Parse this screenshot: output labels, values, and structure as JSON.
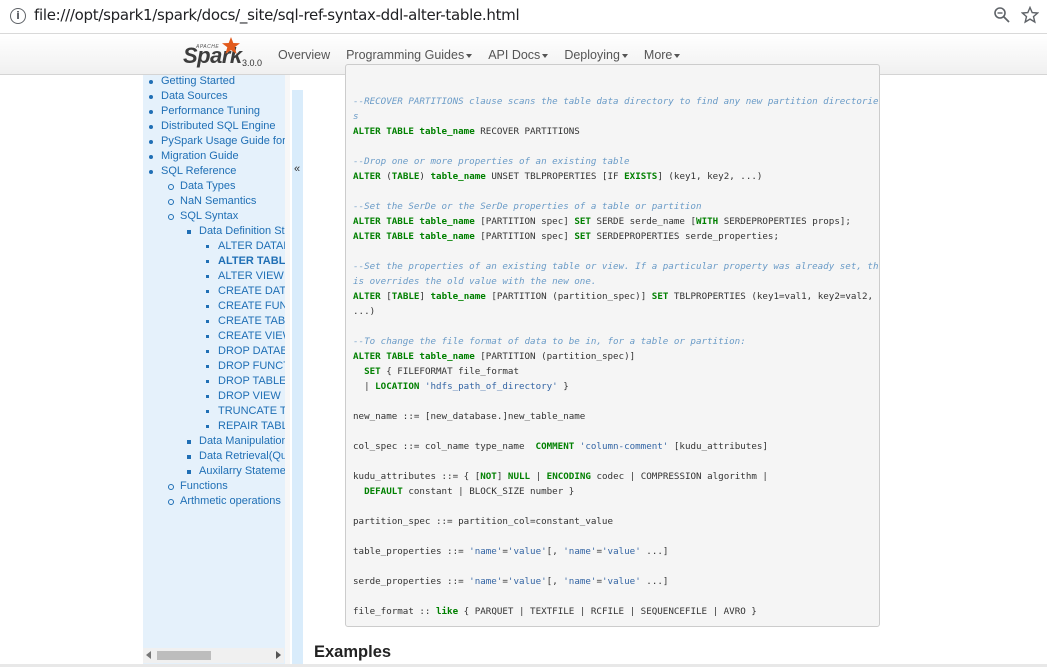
{
  "browser": {
    "url": "file:///opt/spark1/spark/docs/_site/sql-ref-syntax-ddl-alter-table.html",
    "info_icon": "i"
  },
  "navbar": {
    "brand_apache": "APACHE",
    "brand_name": "Spark",
    "version": "3.0.0",
    "items": [
      {
        "label": "Overview",
        "dropdown": false
      },
      {
        "label": "Programming Guides",
        "dropdown": true
      },
      {
        "label": "API Docs",
        "dropdown": true
      },
      {
        "label": "Deploying",
        "dropdown": true
      },
      {
        "label": "More",
        "dropdown": true
      }
    ]
  },
  "sidebar": {
    "items": [
      {
        "label": "Getting Started",
        "level": 0
      },
      {
        "label": "Data Sources",
        "level": 0
      },
      {
        "label": "Performance Tuning",
        "level": 0
      },
      {
        "label": "Distributed SQL Engine",
        "level": 0
      },
      {
        "label": "PySpark Usage Guide for P",
        "level": 0
      },
      {
        "label": "Migration Guide",
        "level": 0
      },
      {
        "label": "SQL Reference",
        "level": 0
      },
      {
        "label": "Data Types",
        "level": 1
      },
      {
        "label": "NaN Semantics",
        "level": 1
      },
      {
        "label": "SQL Syntax",
        "level": 1
      },
      {
        "label": "Data Definition Sta",
        "level": 2
      },
      {
        "label": "ALTER DATAB",
        "level": 3
      },
      {
        "label": "ALTER TABLE",
        "level": 3,
        "active": true
      },
      {
        "label": "ALTER VIEW",
        "level": 3
      },
      {
        "label": "CREATE DATA",
        "level": 3
      },
      {
        "label": "CREATE FUNC",
        "level": 3
      },
      {
        "label": "CREATE TABL",
        "level": 3
      },
      {
        "label": "CREATE VIEW",
        "level": 3
      },
      {
        "label": "DROP DATAB",
        "level": 3
      },
      {
        "label": "DROP FUNCT",
        "level": 3
      },
      {
        "label": "DROP TABLE",
        "level": 3
      },
      {
        "label": "DROP VIEW",
        "level": 3
      },
      {
        "label": "TRUNCATE TA",
        "level": 3
      },
      {
        "label": "REPAIR TABL",
        "level": 3
      },
      {
        "label": "Data Manipulation",
        "level": 2
      },
      {
        "label": "Data Retrieval(Que",
        "level": 2
      },
      {
        "label": "Auxilarry Statemen",
        "level": 2
      },
      {
        "label": "Functions",
        "level": 1
      },
      {
        "label": "Arthmetic operations",
        "level": 1
      }
    ],
    "collapse_glyph": "«"
  },
  "code_lines": [
    [
      [
        "cm",
        "--RECOVER PARTITIONS clause scans the table data directory to find any new partition directorie"
      ]
    ],
    [
      [
        "cm",
        "s"
      ]
    ],
    [
      [
        "kw",
        "ALTER TABLE"
      ],
      [
        "t",
        " "
      ],
      [
        "kw",
        "table_name"
      ],
      [
        "t",
        " RECOVER PARTITIONS"
      ]
    ],
    [],
    [
      [
        "cm",
        "--Drop one or more properties of an existing table"
      ]
    ],
    [
      [
        "kw",
        "ALTER"
      ],
      [
        "t",
        " ("
      ],
      [
        "kw",
        "TABLE"
      ],
      [
        "t",
        ") "
      ],
      [
        "kw",
        "table_name"
      ],
      [
        "t",
        " UNSET TBLPROPERTIES [IF "
      ],
      [
        "kw",
        "EXISTS"
      ],
      [
        "t",
        "] (key1, key2, ...)"
      ]
    ],
    [],
    [
      [
        "cm",
        "--Set the SerDe or the SerDe properties of a table or partition"
      ]
    ],
    [
      [
        "kw",
        "ALTER TABLE"
      ],
      [
        "t",
        " "
      ],
      [
        "kw",
        "table_name"
      ],
      [
        "t",
        " [PARTITION spec] "
      ],
      [
        "kw",
        "SET"
      ],
      [
        "t",
        " SERDE serde_name ["
      ],
      [
        "kw",
        "WITH"
      ],
      [
        "t",
        " SERDEPROPERTIES props];"
      ]
    ],
    [
      [
        "kw",
        "ALTER TABLE"
      ],
      [
        "t",
        " "
      ],
      [
        "kw",
        "table_name"
      ],
      [
        "t",
        " [PARTITION spec] "
      ],
      [
        "kw",
        "SET"
      ],
      [
        "t",
        " SERDEPROPERTIES serde_properties;"
      ]
    ],
    [],
    [
      [
        "cm",
        "--Set the properties of an existing table or view. If a particular property was already set, th"
      ]
    ],
    [
      [
        "cm",
        "is overrides the old value with the new one."
      ]
    ],
    [
      [
        "kw",
        "ALTER"
      ],
      [
        "t",
        " ["
      ],
      [
        "kw",
        "TABLE"
      ],
      [
        "t",
        "] "
      ],
      [
        "kw",
        "table_name"
      ],
      [
        "t",
        " [PARTITION (partition_spec)] "
      ],
      [
        "kw",
        "SET"
      ],
      [
        "t",
        " TBLPROPERTIES (key1=val1, key2=val2,"
      ]
    ],
    [
      [
        "t",
        "...)"
      ]
    ],
    [],
    [
      [
        "cm",
        "--To change the file format of data to be in, for a table or partition:"
      ]
    ],
    [
      [
        "kw",
        "ALTER TABLE"
      ],
      [
        "t",
        " "
      ],
      [
        "kw",
        "table_name"
      ],
      [
        "t",
        " [PARTITION (partition_spec)]"
      ]
    ],
    [
      [
        "t",
        "  "
      ],
      [
        "kw",
        "SET"
      ],
      [
        "t",
        " { FILEFORMAT file_format"
      ]
    ],
    [
      [
        "t",
        "  | "
      ],
      [
        "kw",
        "LOCATION"
      ],
      [
        "t",
        " "
      ],
      [
        "sq",
        "'hdfs_path_of_directory'"
      ],
      [
        "t",
        " }"
      ]
    ],
    [],
    [
      [
        "t",
        "new_name ::= [new_database.]new_table_name"
      ]
    ],
    [],
    [
      [
        "t",
        "col_spec ::= col_name type_name  "
      ],
      [
        "kw",
        "COMMENT"
      ],
      [
        "t",
        " "
      ],
      [
        "sq",
        "'column-comment'"
      ],
      [
        "t",
        " [kudu_attributes]"
      ]
    ],
    [],
    [
      [
        "t",
        "kudu_attributes ::= { ["
      ],
      [
        "kw",
        "NOT"
      ],
      [
        "t",
        "] "
      ],
      [
        "kw",
        "NULL"
      ],
      [
        "t",
        " | "
      ],
      [
        "kw",
        "ENCODING"
      ],
      [
        "t",
        " codec | COMPRESSION algorithm |"
      ]
    ],
    [
      [
        "t",
        "  "
      ],
      [
        "kw",
        "DEFAULT"
      ],
      [
        "t",
        " constant | BLOCK_SIZE number }"
      ]
    ],
    [],
    [
      [
        "t",
        "partition_spec ::= partition_col=constant_value"
      ]
    ],
    [],
    [
      [
        "t",
        "table_properties ::= "
      ],
      [
        "sq",
        "'name'"
      ],
      [
        "t",
        "="
      ],
      [
        "sq",
        "'value'"
      ],
      [
        "t",
        "[, "
      ],
      [
        "sq",
        "'name'"
      ],
      [
        "t",
        "="
      ],
      [
        "sq",
        "'value'"
      ],
      [
        "t",
        " ...]"
      ]
    ],
    [],
    [
      [
        "t",
        "serde_properties ::= "
      ],
      [
        "sq",
        "'name'"
      ],
      [
        "t",
        "="
      ],
      [
        "sq",
        "'value'"
      ],
      [
        "t",
        "[, "
      ],
      [
        "sq",
        "'name'"
      ],
      [
        "t",
        "="
      ],
      [
        "sq",
        "'value'"
      ],
      [
        "t",
        " ...]"
      ]
    ],
    [],
    [
      [
        "t",
        "file_format :: "
      ],
      [
        "kw",
        "like"
      ],
      [
        "t",
        " { PARQUET | TEXTFILE | RCFILE | SEQUENCEFILE | AVRO }"
      ]
    ]
  ],
  "main": {
    "examples_heading": "Examples"
  }
}
